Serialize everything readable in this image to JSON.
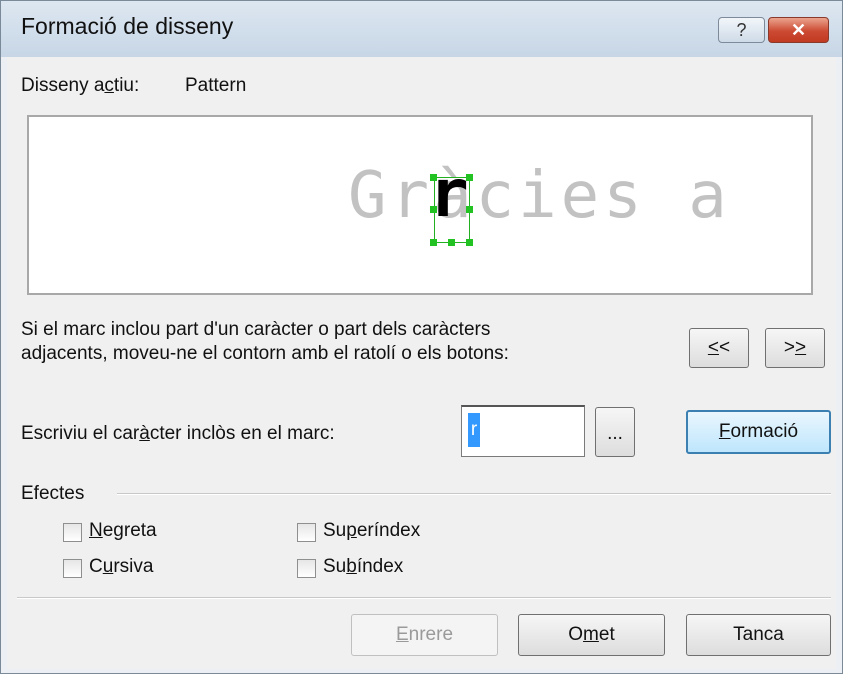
{
  "window": {
    "title": "Formació de disseny",
    "help_icon": "?",
    "close_icon": "✕"
  },
  "design": {
    "label_prefix": "Disseny a",
    "label_mnemonic": "c",
    "label_suffix": "tiu:",
    "value": "Pattern"
  },
  "preview": {
    "text": "Gràcies a",
    "glyph": "r"
  },
  "instructions": {
    "line1": "Si el marc inclou part d'un caràcter o part dels caràcters",
    "line2": "adjacents, moveu-ne el contorn amb el ratolí o els botons:"
  },
  "nav": {
    "prev_mnemonic": "<",
    "prev_rest": "<",
    "next_first": ">",
    "next_mnemonic": ">"
  },
  "char_input": {
    "label_prefix": "Escriviu el car",
    "label_mnemonic": "à",
    "label_suffix": "cter inclòs en el marc:",
    "value": "r",
    "browse_label": "..."
  },
  "train": {
    "mnemonic": "F",
    "rest": "ormació"
  },
  "effects": {
    "title": "Efectes",
    "bold": {
      "mnemonic": "N",
      "rest": "egreta",
      "checked": false
    },
    "italic": {
      "first": "C",
      "mnemonic": "u",
      "rest": "rsiva",
      "checked": false
    },
    "superscript": {
      "first": "Su",
      "mnemonic": "p",
      "rest": "eríndex",
      "checked": false
    },
    "subscript": {
      "first": "Su",
      "mnemonic": "b",
      "rest": "índex",
      "checked": false
    }
  },
  "footer": {
    "back": {
      "mnemonic": "E",
      "rest": "nrere",
      "enabled": false
    },
    "skip": {
      "first": "O",
      "mnemonic": "m",
      "rest": "et"
    },
    "close": "Tanca"
  }
}
